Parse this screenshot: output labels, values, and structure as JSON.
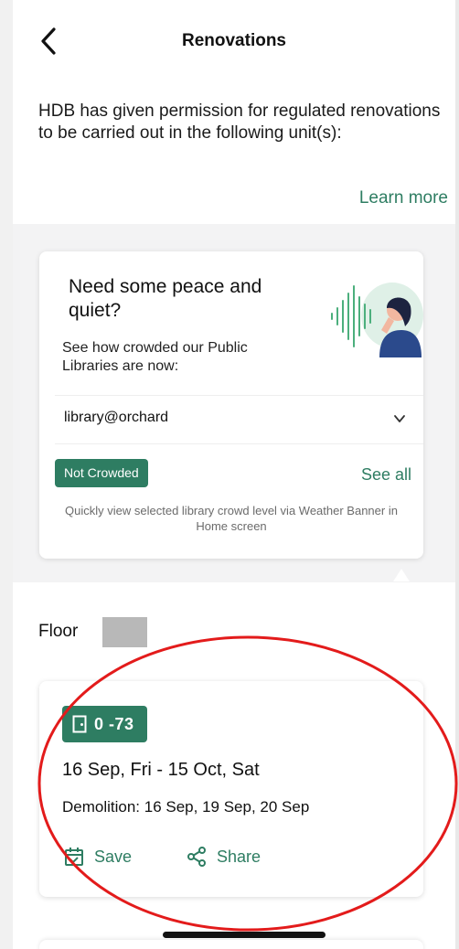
{
  "header": {
    "title": "Renovations"
  },
  "intro": {
    "text": "HDB has given permission for regulated renovations to be carried out in the following unit(s):",
    "learn_more": "Learn more"
  },
  "promo": {
    "title": "Need some peace and quiet?",
    "subtitle": "See how crowded our Public Libraries are now:",
    "library_selected": "library@orchard",
    "crowd_status": "Not Crowded",
    "see_all": "See all",
    "footnote": "Quickly view selected library crowd level via Weather Banner in Home screen"
  },
  "floor": {
    "label": "Floor"
  },
  "renovation": {
    "unit": "0  -73",
    "date_range": "16 Sep, Fri - 15 Oct, Sat",
    "demolition": "Demolition: 16 Sep, 19 Sep, 20 Sep",
    "save_label": "Save",
    "share_label": "Share"
  },
  "colors": {
    "accent_green": "#2e7d62",
    "annotation_red": "#e31b1b"
  },
  "icons": {
    "back": "chevron-left-icon",
    "dropdown": "chevron-down-icon",
    "unit": "door-icon",
    "save": "calendar-icon",
    "share": "share-icon"
  }
}
